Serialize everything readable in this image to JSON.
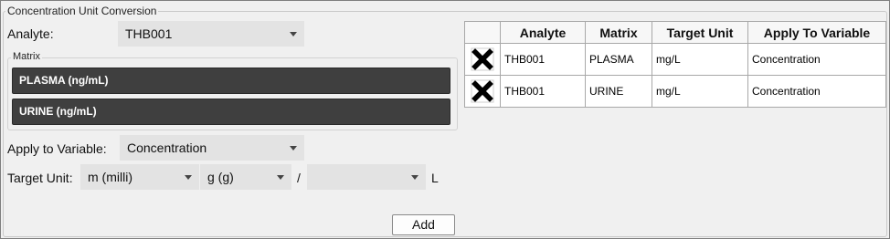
{
  "group": {
    "title": "Concentration Unit Conversion"
  },
  "analyte": {
    "label": "Analyte:",
    "value": "THB001"
  },
  "matrix": {
    "title": "Matrix",
    "items": [
      "PLASMA (ng/mL)",
      "URINE (ng/mL)"
    ]
  },
  "apply_variable": {
    "label": "Apply to Variable:",
    "value": "Concentration"
  },
  "target_unit": {
    "label": "Target Unit:",
    "prefix": "m (milli)",
    "mass": "g (g)",
    "separator": "/",
    "denominator": "",
    "volume_unit": "L"
  },
  "add_button": {
    "label": "Add"
  },
  "table": {
    "headers": [
      "",
      "Analyte",
      "Matrix",
      "Target Unit",
      "Apply To Variable"
    ],
    "rows": [
      {
        "analyte": "THB001",
        "matrix": "PLASMA",
        "unit": "mg/L",
        "variable": "Concentration"
      },
      {
        "analyte": "THB001",
        "matrix": "URINE",
        "unit": "mg/L",
        "variable": "Concentration"
      }
    ]
  },
  "icons": {
    "delete": "delete-x-icon",
    "dropdown": "chevron-down-icon"
  }
}
